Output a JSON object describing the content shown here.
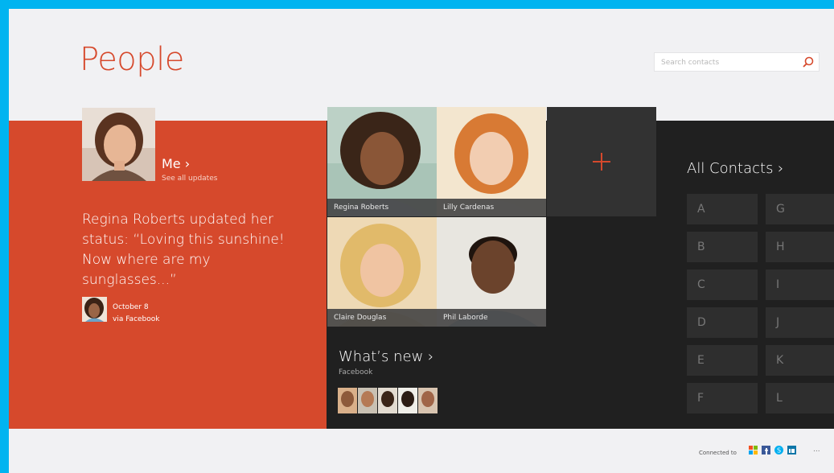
{
  "app": {
    "title": "People"
  },
  "search": {
    "placeholder": "Search contacts"
  },
  "me": {
    "label": "Me ›",
    "sublabel": "See all updates"
  },
  "status_update": {
    "text": "Regina Roberts updated her status: “Loving this sunshine! Now where are my sunglasses...”",
    "date": "October 8",
    "source": "via Facebook"
  },
  "favorites": [
    {
      "name": "Regina Roberts"
    },
    {
      "name": "Lilly Cardenas"
    },
    {
      "name": "Claire Douglas"
    },
    {
      "name": "Phil Laborde"
    }
  ],
  "add_tile": {
    "icon": "plus-icon"
  },
  "whats_new": {
    "title": "What’s new ›",
    "source": "Facebook"
  },
  "all_contacts": {
    "title": "All Contacts ›",
    "letters": [
      "A",
      "G",
      "B",
      "H",
      "C",
      "I",
      "D",
      "J",
      "E",
      "K",
      "F",
      "L"
    ]
  },
  "footer": {
    "connected_label": "Connected to",
    "services": [
      "microsoft-icon",
      "facebook-icon",
      "skype-icon",
      "linkedin-icon"
    ],
    "more": "..."
  },
  "colors": {
    "accent": "#d6492c",
    "dark": "#202020",
    "frame": "#00b4f0",
    "background": "#f1f1f3"
  }
}
